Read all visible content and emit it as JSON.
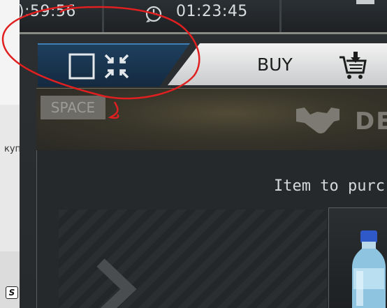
{
  "left_strip": {
    "text": "куп",
    "icon": "s-square-icon"
  },
  "topbar": {
    "time_left": "):59:56",
    "time_right": "01:23:45",
    "timer_icon": "clock-rewind-icon"
  },
  "tabs": {
    "active_icons": [
      "square-icon",
      "compress-arrows-icon"
    ],
    "buy_label": "BUY",
    "buy_icon": "cart-download-icon"
  },
  "deal": {
    "key_hint": "SPACE",
    "title": "DE",
    "icon": "handshake-icon"
  },
  "main": {
    "purchase_label": "Item to purc",
    "item_icon": "water-bottle-icon",
    "nav_icon": "chevron-right-icon"
  },
  "colors": {
    "tab_active": "#1e3f5e",
    "tab_buy": "#e6e6e6",
    "deal_bg": "#3b3729",
    "annotation": "#e02020"
  }
}
